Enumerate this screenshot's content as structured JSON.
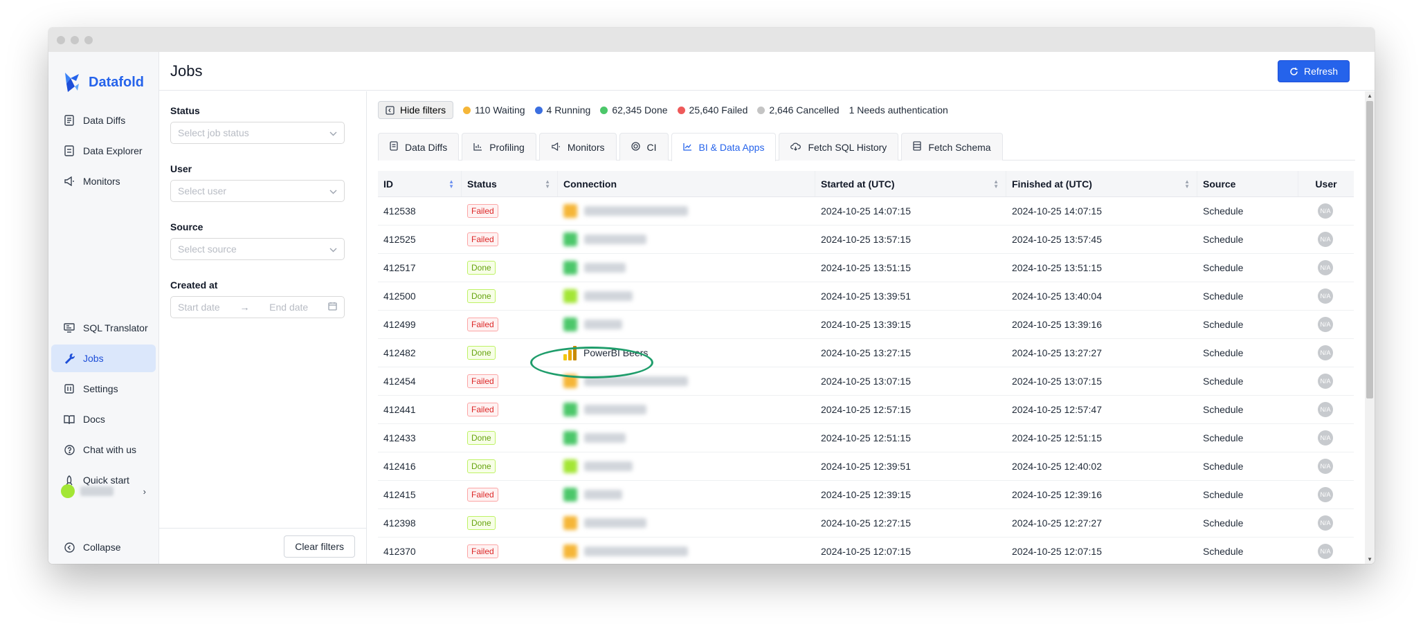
{
  "sidebar": {
    "logo": "Datafold",
    "top_items": [
      {
        "label": "Data Diffs",
        "icon": "file-diff-icon"
      },
      {
        "label": "Data Explorer",
        "icon": "explorer-icon"
      },
      {
        "label": "Monitors",
        "icon": "megaphone-icon"
      }
    ],
    "bottom_items": [
      {
        "label": "SQL Translator",
        "icon": "translator-icon"
      },
      {
        "label": "Jobs",
        "icon": "wrench-icon",
        "active": true
      },
      {
        "label": "Settings",
        "icon": "settings-icon"
      },
      {
        "label": "Docs",
        "icon": "book-icon"
      },
      {
        "label": "Chat with us",
        "icon": "help-circle-icon"
      },
      {
        "label": "Quick start",
        "icon": "rocket-icon"
      }
    ],
    "collapse_label": "Collapse"
  },
  "header": {
    "title": "Jobs",
    "refresh_label": "Refresh"
  },
  "filters": {
    "status_label": "Status",
    "status_placeholder": "Select job status",
    "user_label": "User",
    "user_placeholder": "Select user",
    "source_label": "Source",
    "source_placeholder": "Select source",
    "created_label": "Created at",
    "start_placeholder": "Start date",
    "end_placeholder": "End date",
    "clear_label": "Clear filters"
  },
  "status_bar": {
    "hide_filters": "Hide filters",
    "waiting": "110 Waiting",
    "running": "4 Running",
    "done": "62,345 Done",
    "failed": "25,640 Failed",
    "cancelled": "2,646 Cancelled",
    "needs_auth": "1 Needs authentication",
    "colors": {
      "waiting": "#f5b638",
      "running": "#3b6fe0",
      "done": "#4cc76a",
      "failed": "#ee5a5a",
      "cancelled": "#c4c4c4"
    }
  },
  "tabs": [
    {
      "label": "Data Diffs",
      "icon": "file-icon"
    },
    {
      "label": "Profiling",
      "icon": "bar-chart-icon"
    },
    {
      "label": "Monitors",
      "icon": "megaphone-icon"
    },
    {
      "label": "CI",
      "icon": "ci-icon"
    },
    {
      "label": "BI & Data Apps",
      "icon": "line-chart-icon",
      "active": true
    },
    {
      "label": "Fetch SQL History",
      "icon": "cloud-download-icon"
    },
    {
      "label": "Fetch Schema",
      "icon": "table-icon"
    }
  ],
  "table": {
    "columns": [
      "ID",
      "Status",
      "Connection",
      "Started at (UTC)",
      "Finished at (UTC)",
      "Source",
      "User"
    ],
    "user_placeholder": "N/A",
    "rows": [
      {
        "id": "412538",
        "status": "Failed",
        "conn": "",
        "started": "2024-10-25 14:07:15",
        "finished": "2024-10-25 14:07:15",
        "source": "Schedule"
      },
      {
        "id": "412525",
        "status": "Failed",
        "conn": "",
        "started": "2024-10-25 13:57:15",
        "finished": "2024-10-25 13:57:45",
        "source": "Schedule"
      },
      {
        "id": "412517",
        "status": "Done",
        "conn": "",
        "started": "2024-10-25 13:51:15",
        "finished": "2024-10-25 13:51:15",
        "source": "Schedule"
      },
      {
        "id": "412500",
        "status": "Done",
        "conn": "",
        "started": "2024-10-25 13:39:51",
        "finished": "2024-10-25 13:40:04",
        "source": "Schedule"
      },
      {
        "id": "412499",
        "status": "Failed",
        "conn": "",
        "started": "2024-10-25 13:39:15",
        "finished": "2024-10-25 13:39:16",
        "source": "Schedule"
      },
      {
        "id": "412482",
        "status": "Done",
        "conn": "PowerBI Beers",
        "started": "2024-10-25 13:27:15",
        "finished": "2024-10-25 13:27:27",
        "source": "Schedule"
      },
      {
        "id": "412454",
        "status": "Failed",
        "conn": "",
        "started": "2024-10-25 13:07:15",
        "finished": "2024-10-25 13:07:15",
        "source": "Schedule"
      },
      {
        "id": "412441",
        "status": "Failed",
        "conn": "",
        "started": "2024-10-25 12:57:15",
        "finished": "2024-10-25 12:57:47",
        "source": "Schedule"
      },
      {
        "id": "412433",
        "status": "Done",
        "conn": "",
        "started": "2024-10-25 12:51:15",
        "finished": "2024-10-25 12:51:15",
        "source": "Schedule"
      },
      {
        "id": "412416",
        "status": "Done",
        "conn": "",
        "started": "2024-10-25 12:39:51",
        "finished": "2024-10-25 12:40:02",
        "source": "Schedule"
      },
      {
        "id": "412415",
        "status": "Failed",
        "conn": "",
        "started": "2024-10-25 12:39:15",
        "finished": "2024-10-25 12:39:16",
        "source": "Schedule"
      },
      {
        "id": "412398",
        "status": "Done",
        "conn": "",
        "started": "2024-10-25 12:27:15",
        "finished": "2024-10-25 12:27:27",
        "source": "Schedule"
      },
      {
        "id": "412370",
        "status": "Failed",
        "conn": "",
        "started": "2024-10-25 12:07:15",
        "finished": "2024-10-25 12:07:15",
        "source": "Schedule"
      }
    ]
  }
}
